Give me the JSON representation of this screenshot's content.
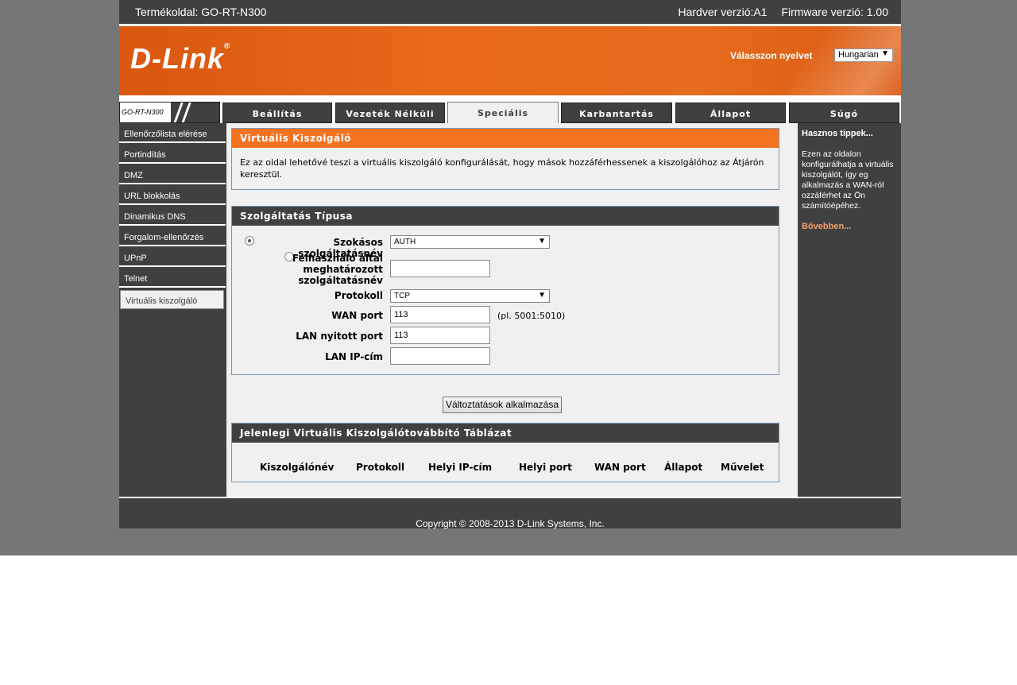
{
  "topbar": {
    "product": "Termékoldal: GO-RT-N300",
    "hardware": "Hardver verzió:A1",
    "firmware": "Firmware verzió: 1.00"
  },
  "banner": {
    "logo": "D-Link",
    "logo_mark": "®",
    "language_label": "Válasszon nyelvet",
    "language_value": "Hungarian"
  },
  "model_tag": "GO-RT-N300",
  "tabs": [
    {
      "label": "Beállítás"
    },
    {
      "label": "Vezeték Nélküli"
    },
    {
      "label": "Speciális"
    },
    {
      "label": "Karbantartás"
    },
    {
      "label": "Állapot"
    },
    {
      "label": "Súgó"
    }
  ],
  "leftnav": [
    {
      "label": "Ellenőrzőlista elérése"
    },
    {
      "label": "Portindítás"
    },
    {
      "label": "DMZ"
    },
    {
      "label": "URL blokkolás"
    },
    {
      "label": "Dinamikus DNS"
    },
    {
      "label": "Forgalom-ellenőrzés"
    },
    {
      "label": "UPnP"
    },
    {
      "label": "Telnet"
    },
    {
      "label": "Virtuális kiszolgáló"
    }
  ],
  "virtual_server": {
    "title": "Virtuális Kiszolgáló",
    "description": "Ez az oldal lehetővé teszi a virtuális kiszolgáló konfigurálását, hogy mások hozzáférhessenek a kiszolgálóhoz az Átjárón keresztül."
  },
  "service_type": {
    "title": "Szolgáltatás Típusa",
    "standard_label": "Szokásos szolgáltatásnév",
    "standard_value": "AUTH",
    "custom_label_1": "Felhasználó által",
    "custom_label_2": "meghatározott",
    "custom_label_3": "szolgáltatásnév",
    "custom_value": "",
    "protocol_label": "Protokoll",
    "protocol_value": "TCP",
    "wan_port_label": "WAN port",
    "wan_port_value": "113",
    "wan_port_hint": "(pl. 5001:5010)",
    "lan_port_label": "LAN nyitott port",
    "lan_port_value": "113",
    "lan_ip_label": "LAN IP-cím",
    "lan_ip_value": ""
  },
  "apply_button": "Változtatások alkalmazása",
  "table": {
    "title": "Jelenlegi Virtuális Kiszolgálótovábbító Táblázat",
    "columns": [
      "Kiszolgálónév",
      "Protokoll",
      "Helyi IP-cím",
      "Helyi port",
      "WAN port",
      "Állapot",
      "Művelet"
    ]
  },
  "help": {
    "title": "Hasznos tippek...",
    "text": "Ezen az oldalon konfigurálhatja a virtuális kiszolgálót, így eg alkalmazás a WAN-ról ozzáférhet az Ön számítóépéhez.",
    "more": "Bővebben..."
  },
  "footer": "Copyright © 2008-2013 D-Link Systems, Inc.",
  "colors": {
    "orange": "#f47321",
    "dark": "#404040",
    "panel_border": "#7e97b3"
  }
}
